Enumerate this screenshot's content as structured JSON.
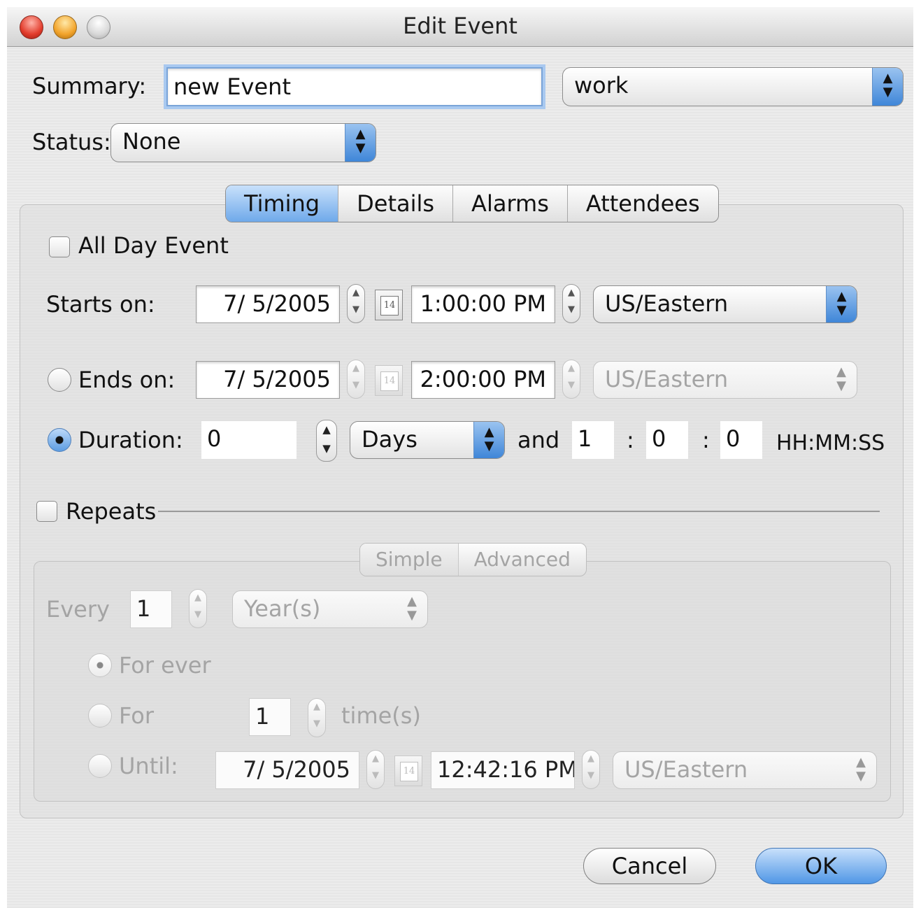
{
  "window": {
    "title": "Edit Event"
  },
  "summary": {
    "label": "Summary:",
    "value": "new Event",
    "calendar": "work"
  },
  "status": {
    "label": "Status:",
    "value": "None"
  },
  "tabs": [
    {
      "label": "Timing",
      "active": true
    },
    {
      "label": "Details",
      "active": false
    },
    {
      "label": "Alarms",
      "active": false
    },
    {
      "label": "Attendees",
      "active": false
    }
  ],
  "timing": {
    "all_day": {
      "label": "All Day Event",
      "checked": false
    },
    "starts": {
      "label": "Starts on:",
      "date": "7/  5/2005",
      "time": "1:00:00 PM",
      "timezone": "US/Eastern"
    },
    "ends": {
      "label": "Ends on:",
      "date": "7/  5/2005",
      "time": "2:00:00 PM",
      "timezone": "US/Eastern",
      "selected": false
    },
    "duration": {
      "label": "Duration:",
      "value": "0",
      "unit": "Days",
      "and_label": "and",
      "hours": "1",
      "minutes": "0",
      "seconds": "0",
      "sep": ":",
      "format_label": "HH:MM:SS",
      "selected": true
    },
    "calendar_icon_text": "14"
  },
  "repeats": {
    "label": "Repeats",
    "checked": false,
    "tabs": [
      {
        "label": "Simple",
        "active": true
      },
      {
        "label": "Advanced",
        "active": false
      }
    ],
    "every": {
      "label": "Every",
      "value": "1",
      "unit": "Year(s)"
    },
    "for_ever": {
      "label": "For ever",
      "selected": true
    },
    "for_times": {
      "label": "For",
      "value": "1",
      "suffix": "time(s)",
      "selected": false
    },
    "until": {
      "label": "Until:",
      "date": "7/  5/2005",
      "time": "12:42:16 PM",
      "timezone": "US/Eastern",
      "selected": false
    }
  },
  "buttons": {
    "cancel": "Cancel",
    "ok": "OK"
  },
  "colors": {
    "accent": "#5097e6",
    "disabled_text": "#a4a4a4"
  }
}
